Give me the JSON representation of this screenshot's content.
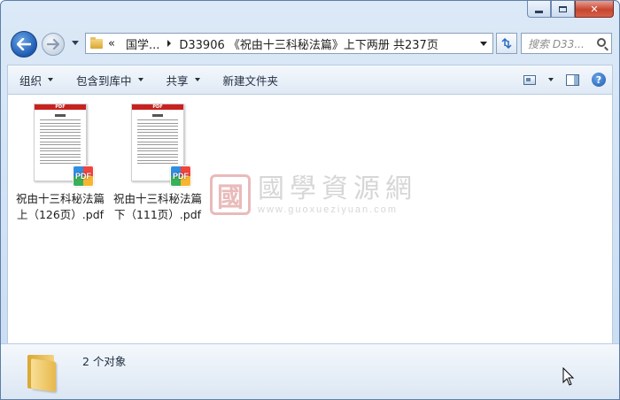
{
  "window": {
    "caption": {
      "minimize": "",
      "maximize": "",
      "close": "✕"
    }
  },
  "address": {
    "overflow": "«",
    "segments": [
      "国学...",
      "D33906 《祝由十三科秘法篇》上下两册 共237页"
    ]
  },
  "search": {
    "placeholder": "搜索 D33..."
  },
  "toolbar": {
    "organize": "组织",
    "include_library": "包含到库中",
    "share": "共享",
    "new_folder": "新建文件夹",
    "help": "?"
  },
  "files": [
    {
      "name_line1": "祝由十三科秘法篇",
      "name_line2": "上（126页）.pdf",
      "badge": "PDF",
      "band": "PDF"
    },
    {
      "name_line1": "祝由十三科秘法篇",
      "name_line2": "下（111页）.pdf",
      "badge": "PDF",
      "band": "PDF"
    }
  ],
  "watermark": {
    "seal": "國",
    "title": "國學資源網",
    "url": "www.guoxueziyuan.com"
  },
  "details": {
    "status": "2 个对象"
  }
}
